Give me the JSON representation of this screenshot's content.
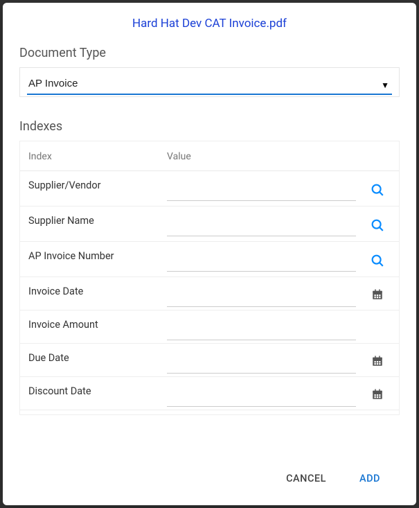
{
  "title": "Hard Hat Dev CAT Invoice.pdf",
  "document_type": {
    "label": "Document Type",
    "selected": "AP Invoice"
  },
  "indexes": {
    "label": "Indexes",
    "header_index": "Index",
    "header_value": "Value",
    "rows": [
      {
        "name": "Supplier/Vendor",
        "value": "",
        "icon": "search"
      },
      {
        "name": "Supplier Name",
        "value": "",
        "icon": "search"
      },
      {
        "name": "AP Invoice Number",
        "value": "",
        "icon": "search"
      },
      {
        "name": "Invoice Date",
        "value": "",
        "icon": "calendar"
      },
      {
        "name": "Invoice Amount",
        "value": "",
        "icon": "none"
      },
      {
        "name": "Due Date",
        "value": "",
        "icon": "calendar"
      },
      {
        "name": "Discount Date",
        "value": "",
        "icon": "calendar"
      }
    ]
  },
  "actions": {
    "cancel": "CANCEL",
    "add": "ADD"
  }
}
